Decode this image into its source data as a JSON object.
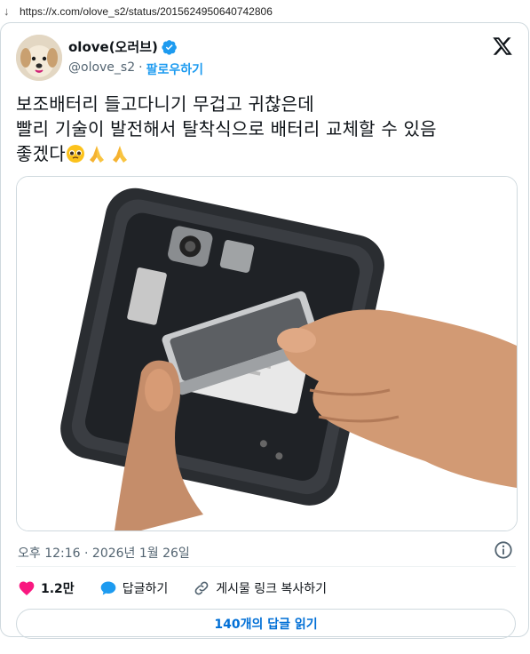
{
  "browser": {
    "url": "https://x.com/olove_s2/status/2015624950640742806"
  },
  "author": {
    "display_name": "olove(오러브)",
    "handle": "@olove_s2",
    "separator": "·",
    "follow_label": "팔로우하기",
    "verified": true
  },
  "tweet": {
    "text": "보조배터리 들고다니기 무겁고 귀찮은데\n빨리 기술이 발전해서 탈착식으로 배터리 교체할 수 있음\n좋겠다",
    "emojis": [
      "pleading-face",
      "folded-hands",
      "folded-hands"
    ],
    "image_description": "phone-battery-removal-photo"
  },
  "meta": {
    "timestamp": "오후 12:16 · 2026년 1월 26일"
  },
  "actions": {
    "like_count": "1.2만",
    "reply_label": "답글하기",
    "copy_link_label": "게시물 링크 복사하기"
  },
  "read_replies_label": "140개의 답글 읽기",
  "colors": {
    "accent": "#1d9bf0",
    "like": "#f91880",
    "link": "#006fd6"
  }
}
